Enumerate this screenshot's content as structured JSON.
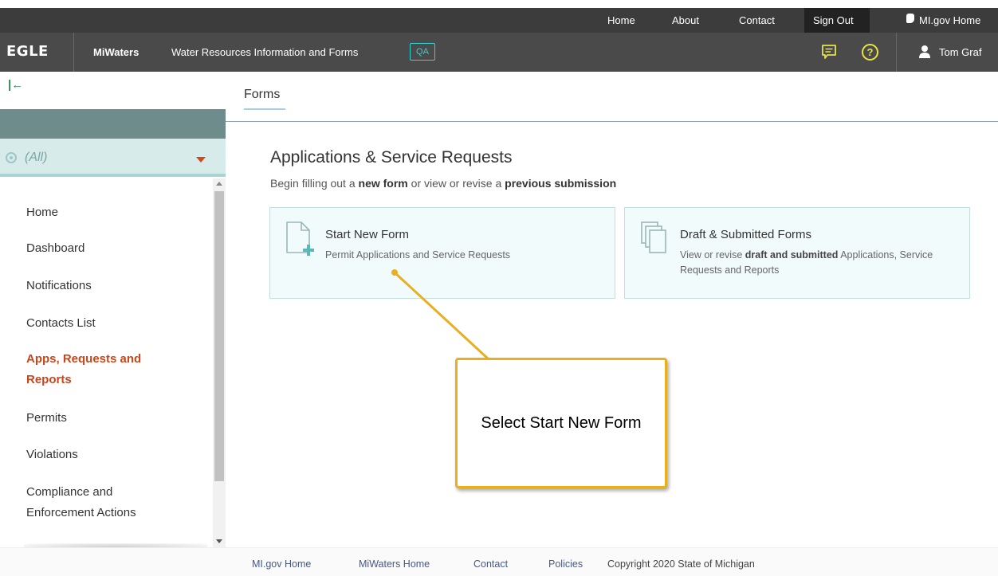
{
  "top_nav": {
    "home": "Home",
    "about": "About",
    "contact": "Contact",
    "sign_out": "Sign Out",
    "migov_home": "MI.gov Home"
  },
  "app_bar": {
    "logo": "EGLE",
    "app_name": "MiWaters",
    "subtitle": "Water Resources Information and Forms",
    "env_badge": "QA",
    "help_glyph": "?",
    "user_name": "Tom Graf",
    "icons": [
      "chat-icon",
      "help-icon",
      "user-icon"
    ],
    "accent_color": "#2ed3d3",
    "help_color": "#e8e24a"
  },
  "sidebar": {
    "collapse_glyph": "|←",
    "select_value": "(All)",
    "items": [
      {
        "label": "Home"
      },
      {
        "label": "Dashboard"
      },
      {
        "label": "Notifications"
      },
      {
        "label": "Contacts List"
      },
      {
        "label": "Apps, Requests and Reports",
        "active": true
      },
      {
        "label": "Permits"
      },
      {
        "label": "Violations"
      },
      {
        "label": "Compliance and Enforcement Actions"
      }
    ],
    "active_color": "#c8461a"
  },
  "main": {
    "tab": "Forms",
    "title": "Applications & Service Requests",
    "subtitle_parts": [
      "Begin filling out a ",
      "new form",
      " or view or revise a ",
      "previous submission"
    ],
    "cards": [
      {
        "title": "Start New Form",
        "desc": "Permit Applications and Service Requests",
        "icon": "new-document-icon"
      },
      {
        "title": "Draft & Submitted Forms",
        "desc_parts": [
          "View or revise ",
          "draft and submitted",
          " Applications, Service Requests and Reports"
        ],
        "icon": "documents-stack-icon"
      }
    ]
  },
  "callout": {
    "text": "Select Start New Form",
    "color": "#e8b020"
  },
  "footer": {
    "links": [
      "MI.gov Home",
      "MiWaters Home",
      "Contact",
      "Policies"
    ],
    "copyright": "Copyright 2020 State of Michigan"
  }
}
